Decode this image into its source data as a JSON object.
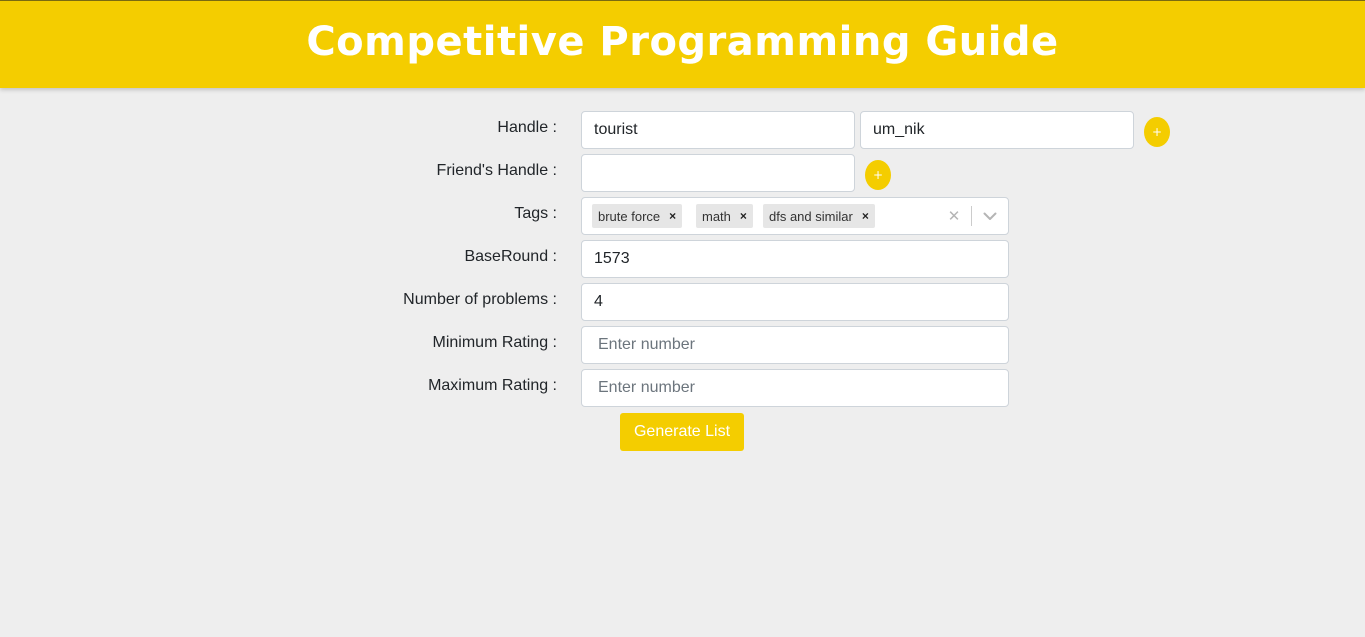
{
  "header": {
    "title": "Competitive Programming Guide"
  },
  "form": {
    "handle": {
      "label": "Handle :",
      "values": [
        "tourist",
        "um_nik"
      ],
      "add_label": "+"
    },
    "friend_handle": {
      "label": "Friend's Handle :",
      "value": "",
      "add_label": "+"
    },
    "tags": {
      "label": "Tags :",
      "selected": [
        {
          "label": "brute force",
          "remove": "×"
        },
        {
          "label": "math",
          "remove": "×"
        },
        {
          "label": "dfs and similar",
          "remove": "×"
        }
      ],
      "clear_glyph": "✕"
    },
    "base_round": {
      "label": "BaseRound :",
      "value": "1573"
    },
    "num_problems": {
      "label": "Number of problems :",
      "value": "4"
    },
    "min_rating": {
      "label": "Minimum Rating :",
      "value": "",
      "placeholder": "Enter number"
    },
    "max_rating": {
      "label": "Maximum Rating :",
      "value": "",
      "placeholder": "Enter number"
    },
    "generate_label": "Generate List"
  },
  "colors": {
    "accent": "#f4cd00",
    "background": "#eeeeee",
    "border": "#ced4da"
  }
}
